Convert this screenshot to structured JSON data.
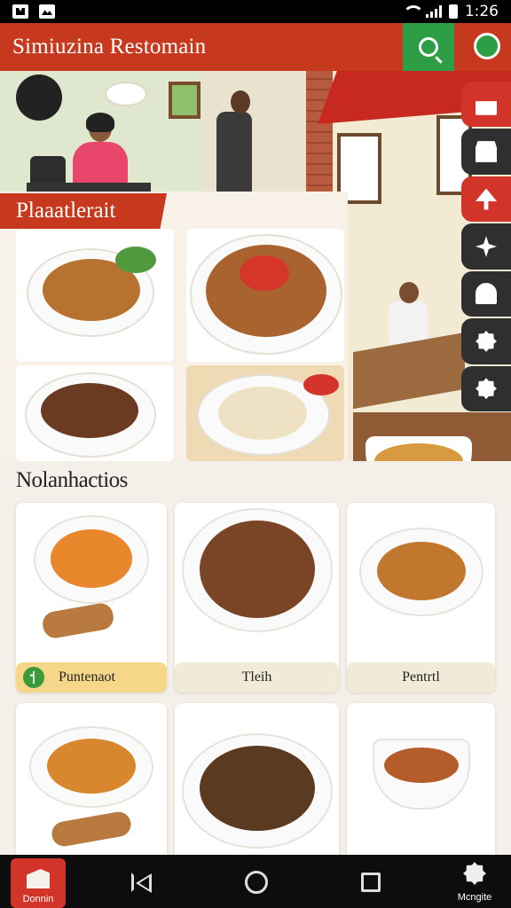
{
  "status_bar": {
    "time": "1:26"
  },
  "app_bar": {
    "title": "Simiuzina Restomain"
  },
  "hero": {
    "panel_label": "Plaaatlerait"
  },
  "section": {
    "title": "Nolanhactios"
  },
  "menu": {
    "cards": [
      {
        "label": "Puntenaot",
        "active": true
      },
      {
        "label": "Tleih",
        "active": false
      },
      {
        "label": "Pentrtl",
        "active": false
      },
      {
        "label": "",
        "active": false
      },
      {
        "label": "",
        "active": false
      },
      {
        "label": "",
        "active": false
      }
    ]
  },
  "bottom_nav": {
    "home_label": "Donnin",
    "settings_label": "Mcngite"
  },
  "colors": {
    "brand": "#c7391f",
    "accent_green": "#2e9e46",
    "rail_red": "#d2342a",
    "rail_dark": "#2f2f2f",
    "active_label": "#f6d78a"
  },
  "icons": {
    "rail": [
      "gift-icon",
      "store-icon",
      "tree-icon",
      "flower-icon",
      "ghost-icon",
      "gear-icon",
      "gear-icon"
    ],
    "app_bar": [
      "search-icon",
      "chat-icon"
    ]
  }
}
